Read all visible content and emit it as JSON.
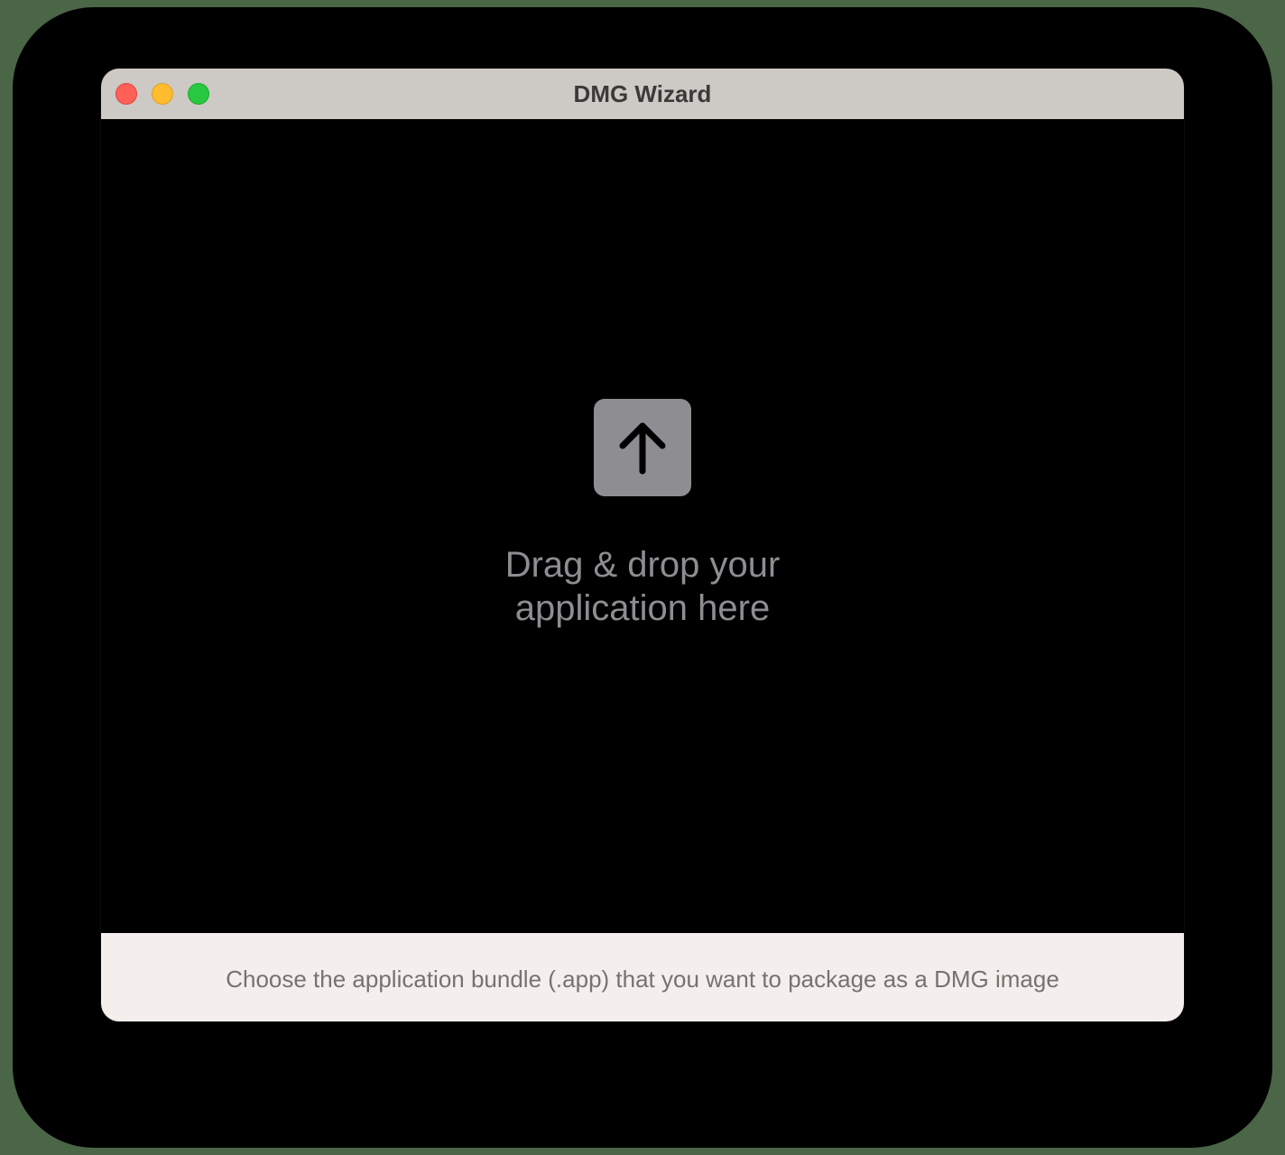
{
  "window": {
    "title": "DMG Wizard"
  },
  "traffic_lights": {
    "close": {
      "icon": "close-icon",
      "color": "#fe5f57"
    },
    "minimize": {
      "icon": "minimize-icon",
      "color": "#febc2e"
    },
    "zoom": {
      "icon": "zoom-icon",
      "color": "#28c840"
    }
  },
  "dropzone": {
    "icon": "upload-arrow-icon",
    "icon_color": "#8e8e92",
    "text_line1": "Drag & drop your",
    "text_line2": "application here"
  },
  "footer": {
    "hint": "Choose the application bundle (.app) that you want to package as a DMG image"
  }
}
